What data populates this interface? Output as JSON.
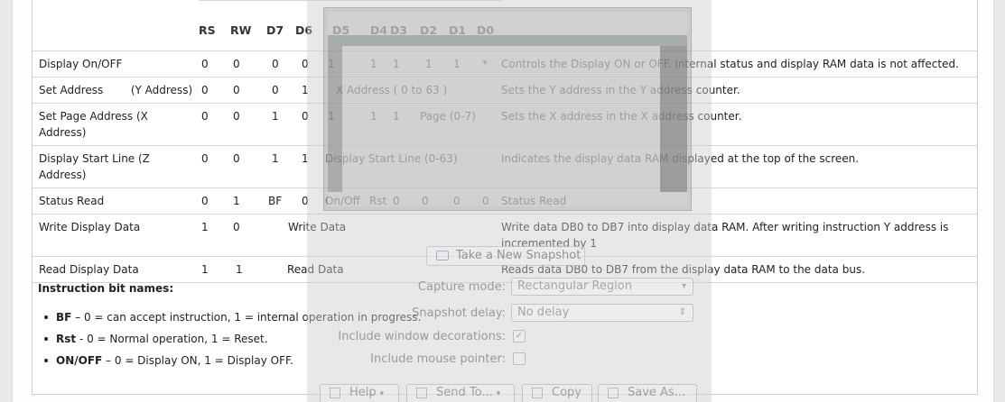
{
  "table": {
    "headers": [
      "RS",
      "RW",
      "D7",
      "D6",
      "D5",
      "D4",
      "D3",
      "D2",
      "D1",
      "D0"
    ],
    "rows": [
      {
        "name": "Display On/OFF",
        "rs": "0",
        "rw": "0",
        "d7": "0",
        "d6": "0",
        "d5": "1",
        "d4": "1",
        "d3": "1",
        "d2": "1",
        "d1": "1",
        "d0": "*",
        "desc": "Controls the Display ON or OFF. Internal status and display RAM data is not affected."
      },
      {
        "name": "Set Address        (Y Address)",
        "rs": "0",
        "rw": "0",
        "d7": "0",
        "d6": "1",
        "span": "X Address ( 0 to 63 )",
        "desc": "Sets the Y address in the Y address counter."
      },
      {
        "name": "Set Page Address  (X Address)",
        "rs": "0",
        "rw": "0",
        "d7": "1",
        "d6": "0",
        "d5": "1",
        "d4": "1",
        "d3": "1",
        "span": "Page (0-7)",
        "desc": "Sets the X address in the X address counter."
      },
      {
        "name": "Display Start Line  (Z Address)",
        "rs": "0",
        "rw": "0",
        "d7": "1",
        "d6": "1",
        "span": "Display Start Line (0-63)",
        "desc": "Indicates the display data RAM displayed at the top of the screen."
      },
      {
        "name": "Status Read",
        "rs": "0",
        "rw": "1",
        "d7": "BF",
        "d6": "0",
        "d5": "On/Off",
        "d4": "Rst",
        "d3": "0",
        "d2": "0",
        "d1": "0",
        "d0": "0",
        "desc": "Status Read"
      },
      {
        "name": "Write Display Data",
        "rs": "1",
        "rw": "0",
        "span": "Write Data",
        "desc": "Write data DB0 to DB7 into display data RAM. After writing instruction Y address is incremented by 1"
      },
      {
        "name": "Read Display Data",
        "rs": "1",
        "rw": "1",
        "span": "Read Data",
        "desc": "Reads data DB0 to DB7 from the display data RAM to the data bus."
      }
    ]
  },
  "instruction_bits": {
    "title": "Instruction bit names:",
    "items": [
      {
        "key": "BF",
        "text": " – 0 = can accept instruction, 1 = internal operation in progress."
      },
      {
        "key": "Rst",
        "text": " - 0 = Normal operation, 1 = Reset."
      },
      {
        "key": "ON/OFF",
        "text": " – 0 = Display ON, 1 = Display OFF."
      }
    ]
  },
  "dialog": {
    "take_snapshot": "Take a New Snapshot",
    "capture_mode_label": "Capture mode:",
    "capture_mode_value": "Rectangular Region",
    "snapshot_delay_label": "Snapshot delay:",
    "snapshot_delay_value": "No delay",
    "include_decorations_label": "Include window decorations:",
    "include_pointer_label": "Include mouse pointer:",
    "buttons": {
      "help": "Help",
      "send_to": "Send To...",
      "copy": "Copy",
      "save_as": "Save As..."
    }
  }
}
